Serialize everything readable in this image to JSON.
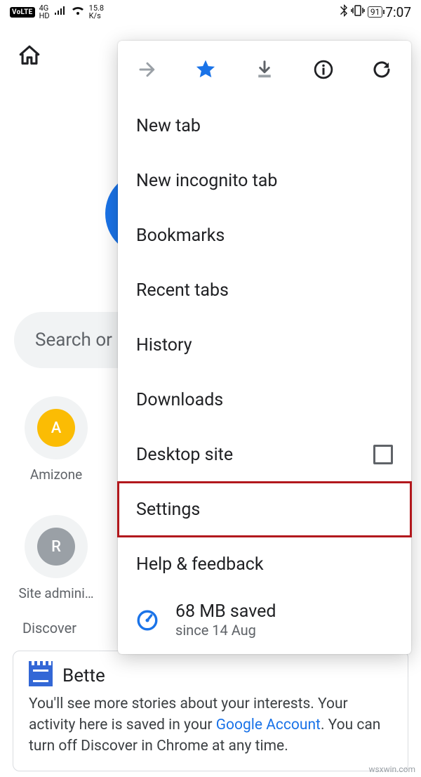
{
  "status": {
    "volte": "VoLTE",
    "net_top": "4G",
    "net_bot": "HD",
    "speed_top": "15.8",
    "speed_bot": "K/s",
    "battery": "91",
    "time": "7:07"
  },
  "search_placeholder": "Search or",
  "shortcuts": [
    {
      "letter": "A",
      "color": "#fbbc04",
      "label": "Amizone"
    },
    {
      "letter": "R",
      "color": "#9aa0a6",
      "label": "Site admini…"
    }
  ],
  "discover_label": "Discover",
  "card": {
    "title": "Bette",
    "body_prefix": "You'll see more stories about your interests. Your activity here is saved in your ",
    "link": "Google Account",
    "body_suffix": ". You can turn off Discover in Chrome at any time."
  },
  "menu": {
    "items": {
      "new_tab": "New tab",
      "incognito": "New incognito tab",
      "bookmarks": "Bookmarks",
      "recent": "Recent tabs",
      "history": "History",
      "downloads": "Downloads",
      "desktop": "Desktop site",
      "settings": "Settings",
      "help": "Help & feedback"
    },
    "data_saved": {
      "line1": "68 MB saved",
      "line2": "since 14 Aug"
    }
  },
  "watermark": "wsxwin.com"
}
